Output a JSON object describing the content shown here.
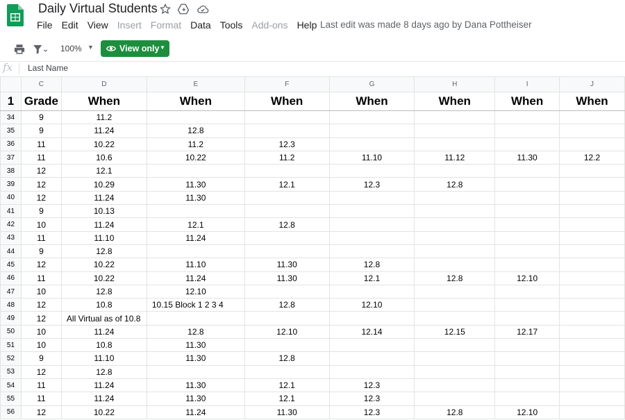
{
  "app": {
    "title": "Daily Virtual Students",
    "menu": [
      {
        "label": "File",
        "enabled": true
      },
      {
        "label": "Edit",
        "enabled": true
      },
      {
        "label": "View",
        "enabled": true
      },
      {
        "label": "Insert",
        "enabled": false
      },
      {
        "label": "Format",
        "enabled": false
      },
      {
        "label": "Data",
        "enabled": true
      },
      {
        "label": "Tools",
        "enabled": true
      },
      {
        "label": "Add-ons",
        "enabled": false
      },
      {
        "label": "Help",
        "enabled": true
      }
    ],
    "last_edit": "Last edit was made 8 days ago by Dana Pottheiser",
    "brand_color": "#0f9d58",
    "view_only_color": "#1e8e3e"
  },
  "toolbar": {
    "zoom": "100%",
    "view_only_label": "View only",
    "icons": [
      "print-icon",
      "filter-icon",
      "eye-icon"
    ]
  },
  "formula_bar": {
    "fx_label": "fx",
    "content": "Last Name"
  },
  "sheet": {
    "columns": [
      "C",
      "D",
      "E",
      "F",
      "G",
      "H",
      "I",
      "J"
    ],
    "header_row": {
      "number": "1",
      "cells": [
        "Grade",
        "When",
        "When",
        "When",
        "When",
        "When",
        "When",
        "When"
      ]
    },
    "rows": [
      {
        "n": "34",
        "c": [
          "9",
          "11.2",
          "",
          "",
          "",
          "",
          "",
          ""
        ]
      },
      {
        "n": "35",
        "c": [
          "9",
          "11.24",
          "12.8",
          "",
          "",
          "",
          "",
          ""
        ]
      },
      {
        "n": "36",
        "c": [
          "11",
          "10.22",
          "11.2",
          "12.3",
          "",
          "",
          "",
          ""
        ]
      },
      {
        "n": "37",
        "c": [
          "11",
          "10.6",
          "10.22",
          "11.2",
          "11.10",
          "11.12",
          "11.30",
          "12.2"
        ]
      },
      {
        "n": "38",
        "c": [
          "12",
          "12.1",
          "",
          "",
          "",
          "",
          "",
          ""
        ]
      },
      {
        "n": "39",
        "c": [
          "12",
          "10.29",
          "11.30",
          "12.1",
          "12.3",
          "12.8",
          "",
          ""
        ]
      },
      {
        "n": "40",
        "c": [
          "12",
          "11.24",
          "11.30",
          "",
          "",
          "",
          "",
          ""
        ]
      },
      {
        "n": "41",
        "c": [
          "9",
          "10.13",
          "",
          "",
          "",
          "",
          "",
          ""
        ]
      },
      {
        "n": "42",
        "c": [
          "10",
          "11.24",
          "12.1",
          "12.8",
          "",
          "",
          "",
          ""
        ]
      },
      {
        "n": "43",
        "c": [
          "11",
          "11.10",
          "11.24",
          "",
          "",
          "",
          "",
          ""
        ]
      },
      {
        "n": "44",
        "c": [
          "9",
          "12.8",
          "",
          "",
          "",
          "",
          "",
          ""
        ]
      },
      {
        "n": "45",
        "c": [
          "12",
          "10.22",
          "11.10",
          "11.30",
          "12.8",
          "",
          "",
          ""
        ]
      },
      {
        "n": "46",
        "c": [
          "11",
          "10.22",
          "11.24",
          "11.30",
          "12.1",
          "12.8",
          "12.10",
          ""
        ]
      },
      {
        "n": "47",
        "c": [
          "10",
          "12.8",
          "12.10",
          "",
          "",
          "",
          "",
          ""
        ]
      },
      {
        "n": "48",
        "c": [
          "12",
          "10.8",
          "10.15  Block 1 2 3 4",
          "12.8",
          "12.10",
          "",
          "",
          ""
        ]
      },
      {
        "n": "49",
        "c": [
          "12",
          "All Virtual as of 10.8",
          "",
          "",
          "",
          "",
          "",
          ""
        ]
      },
      {
        "n": "50",
        "c": [
          "10",
          "11.24",
          "12.8",
          "12.10",
          "12.14",
          "12.15",
          "12.17",
          ""
        ]
      },
      {
        "n": "51",
        "c": [
          "10",
          "10.8",
          "11.30",
          "",
          "",
          "",
          "",
          ""
        ]
      },
      {
        "n": "52",
        "c": [
          "9",
          "11.10",
          "11.30",
          "12.8",
          "",
          "",
          "",
          ""
        ]
      },
      {
        "n": "53",
        "c": [
          "12",
          "12.8",
          "",
          "",
          "",
          "",
          "",
          ""
        ]
      },
      {
        "n": "54",
        "c": [
          "11",
          "11.24",
          "11.30",
          "12.1",
          "12.3",
          "",
          "",
          ""
        ]
      },
      {
        "n": "55",
        "c": [
          "11",
          "11.24",
          "11.30",
          "12.1",
          "12.3",
          "",
          "",
          ""
        ]
      },
      {
        "n": "56",
        "c": [
          "12",
          "10.22",
          "11.24",
          "11.30",
          "12.3",
          "12.8",
          "12.10",
          ""
        ]
      }
    ]
  }
}
